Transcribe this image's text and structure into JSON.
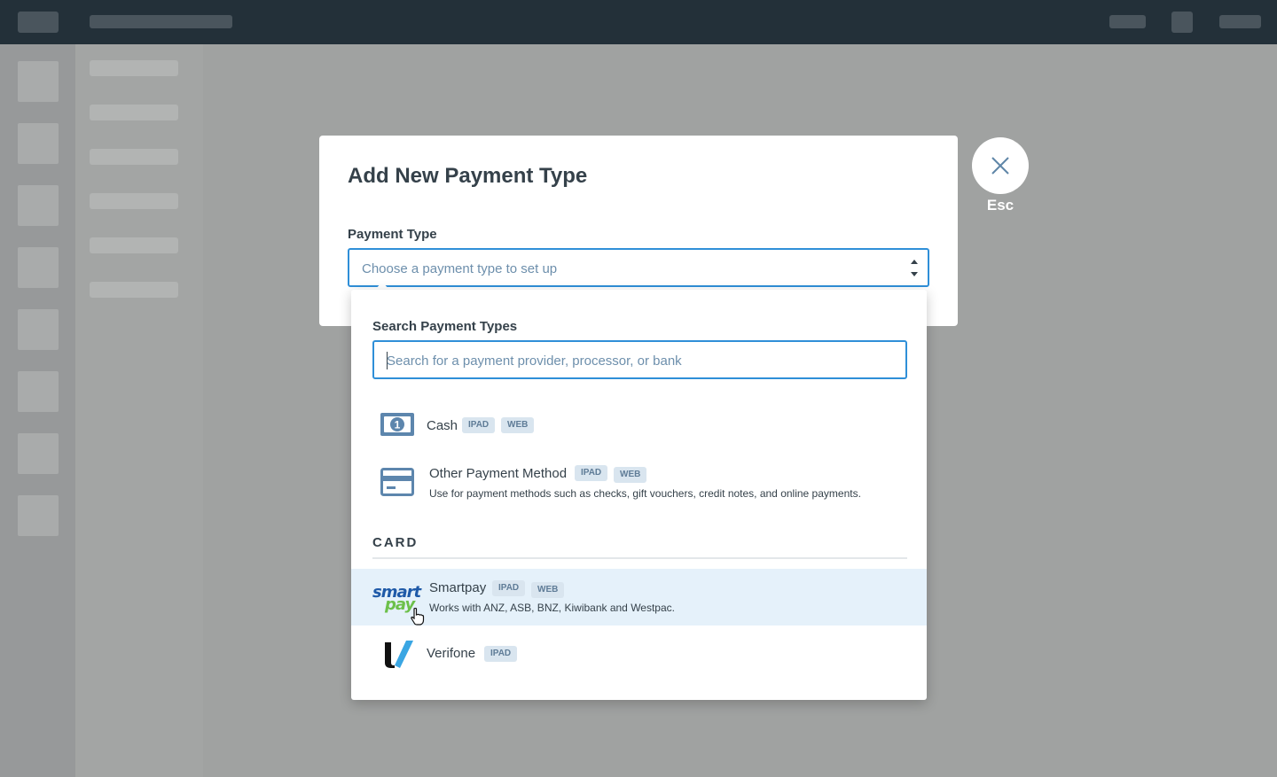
{
  "modal": {
    "title": "Add New Payment Type",
    "field_label": "Payment Type",
    "select_placeholder": "Choose a payment type to set up"
  },
  "close": {
    "label": "Esc",
    "icon": "close-icon"
  },
  "dropdown": {
    "search_label": "Search Payment Types",
    "search_placeholder": "Search for a payment provider, processor, or bank",
    "options": [
      {
        "name": "Cash",
        "icon": "cash-icon",
        "tags": [
          "IPAD",
          "WEB"
        ]
      },
      {
        "name": "Other Payment Method",
        "icon": "credit-card-icon",
        "tags": [
          "IPAD",
          "WEB"
        ],
        "description": "Use for payment methods such as checks, gift vouchers, credit notes, and online payments."
      }
    ],
    "category": "CARD",
    "card_options": [
      {
        "name": "Smartpay",
        "icon": "smartpay-logo",
        "logo_text_top": "smart",
        "logo_text_bottom": "pay",
        "tags": [
          "IPAD",
          "WEB"
        ],
        "description": "Works with ANZ, ASB, BNZ, Kiwibank and Westpac.",
        "hovered": true
      },
      {
        "name": "Verifone",
        "icon": "verifone-logo",
        "tags": [
          "IPAD"
        ]
      }
    ]
  },
  "colors": {
    "accent": "#2f8fd8",
    "text": "#35414a",
    "hover_bg": "#e5f1fa",
    "tag_bg": "#d9e5ef",
    "smartpay_blue": "#1f5aa8",
    "smartpay_green": "#6cc04a"
  }
}
